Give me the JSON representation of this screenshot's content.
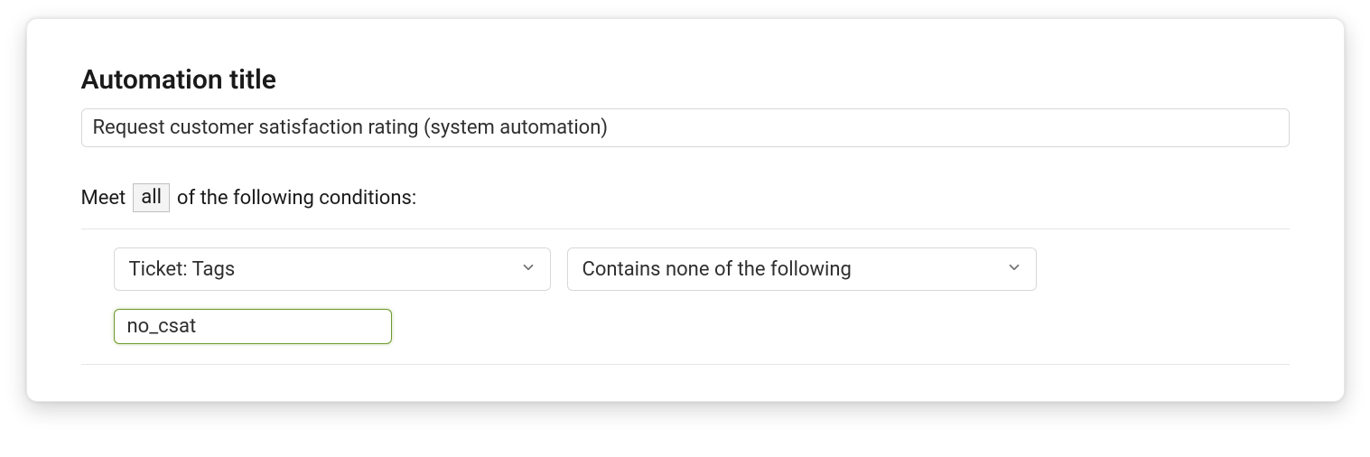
{
  "header": {
    "title_label": "Automation title",
    "title_value": "Request customer satisfaction rating (system automation)"
  },
  "conditions": {
    "sentence_prefix": "Meet",
    "match_type": "all",
    "sentence_suffix": "of the following conditions:",
    "rows": [
      {
        "field": "Ticket: Tags",
        "operator": "Contains none of the following",
        "value": "no_csat"
      }
    ]
  }
}
